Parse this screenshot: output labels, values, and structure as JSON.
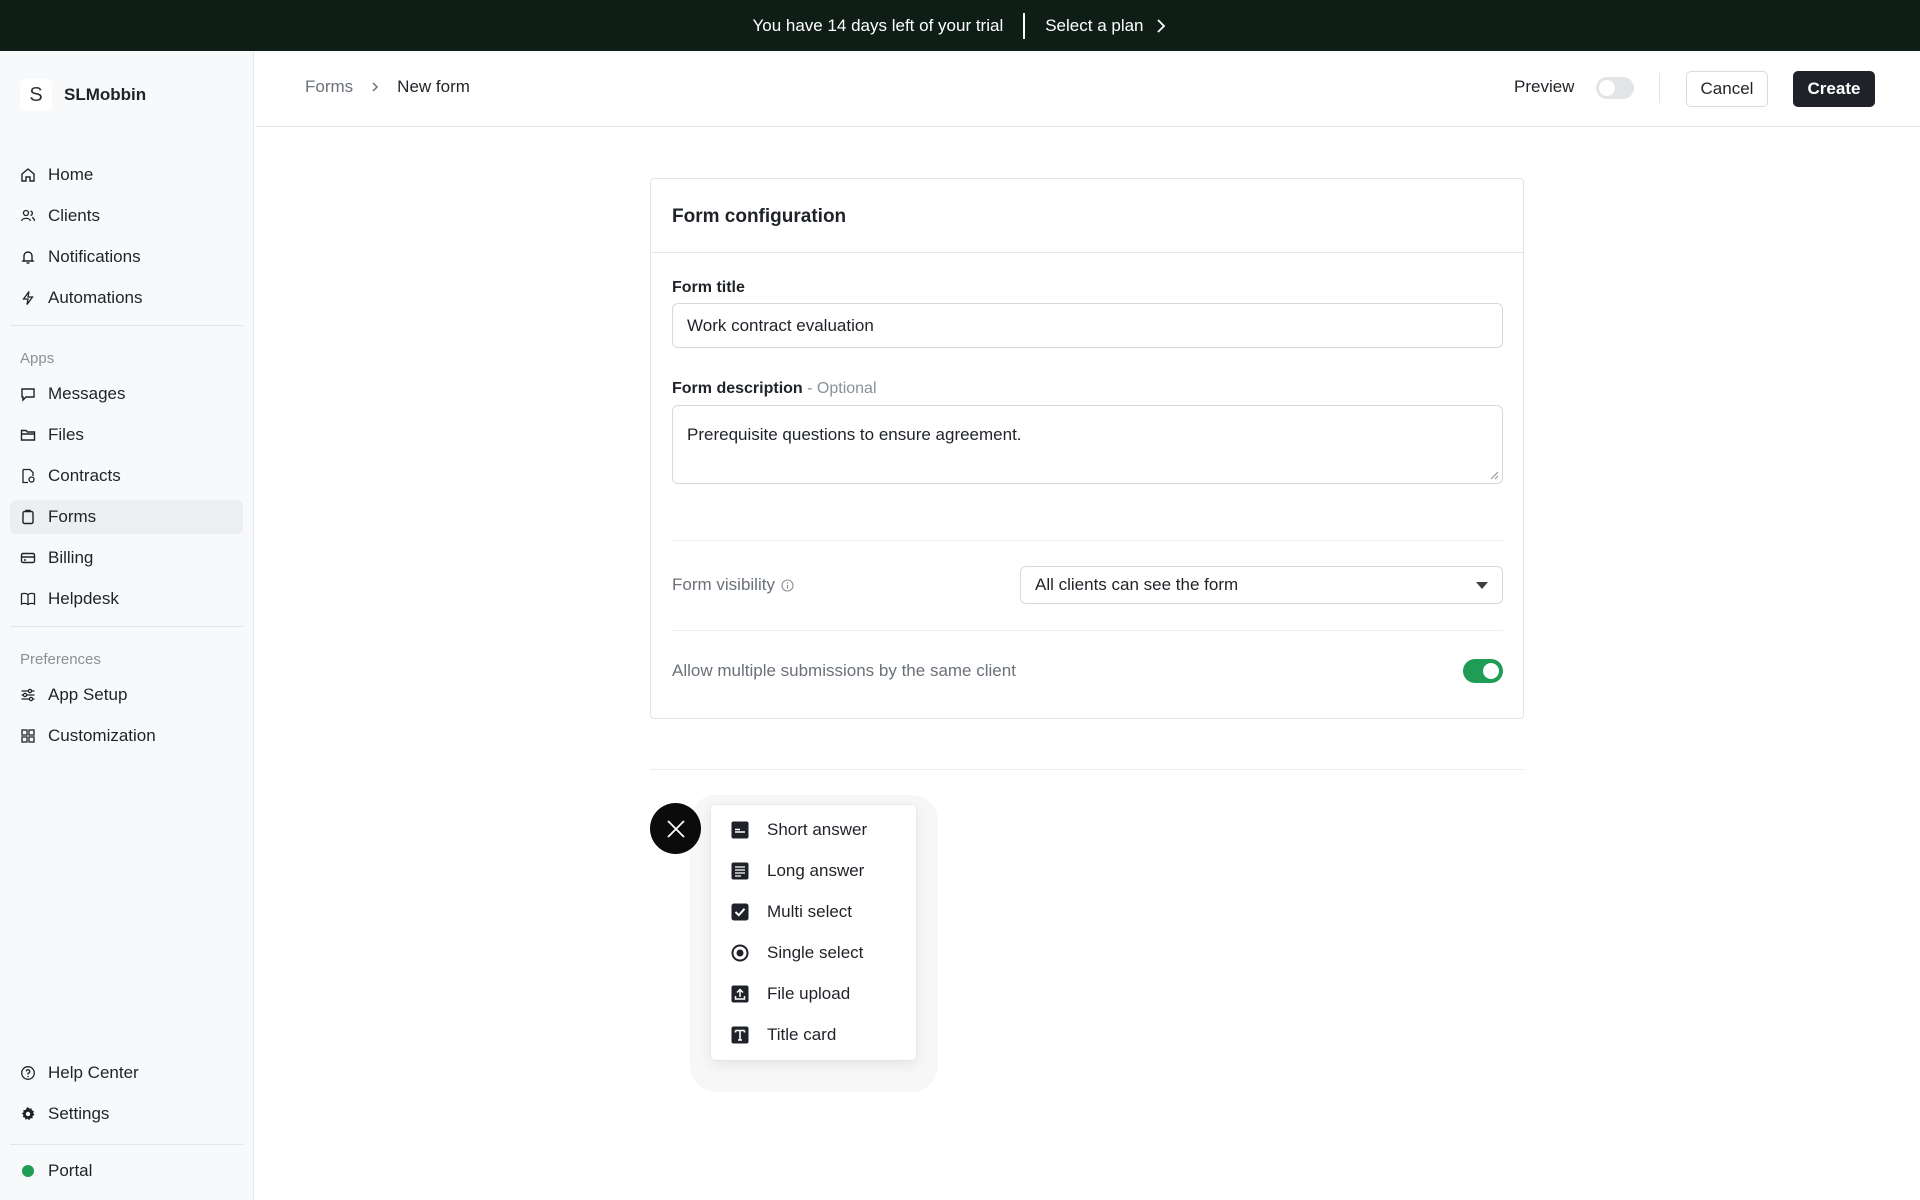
{
  "banner": {
    "trial_text": "You have 14 days left of your trial",
    "cta": "Select a plan"
  },
  "workspace": {
    "logo_letter": "S",
    "name": "SLMobbin"
  },
  "sidebar": {
    "main": [
      {
        "label": "Home",
        "icon": "home-icon"
      },
      {
        "label": "Clients",
        "icon": "users-icon"
      },
      {
        "label": "Notifications",
        "icon": "bell-icon"
      },
      {
        "label": "Automations",
        "icon": "bolt-icon"
      }
    ],
    "apps_label": "Apps",
    "apps": [
      {
        "label": "Messages",
        "icon": "message-icon"
      },
      {
        "label": "Files",
        "icon": "folder-icon"
      },
      {
        "label": "Contracts",
        "icon": "contract-icon"
      },
      {
        "label": "Forms",
        "icon": "clipboard-icon",
        "active": true
      },
      {
        "label": "Billing",
        "icon": "credit-card-icon"
      },
      {
        "label": "Helpdesk",
        "icon": "book-icon"
      }
    ],
    "prefs_label": "Preferences",
    "prefs": [
      {
        "label": "App Setup",
        "icon": "sliders-icon"
      },
      {
        "label": "Customization",
        "icon": "grid-icon"
      }
    ],
    "bottom": [
      {
        "label": "Help Center",
        "icon": "help-circle-icon"
      },
      {
        "label": "Settings",
        "icon": "gear-icon"
      }
    ],
    "portal": "Portal",
    "portal_status_color": "#1f9d55"
  },
  "header": {
    "breadcrumb": [
      "Forms",
      "New form"
    ],
    "preview_label": "Preview",
    "preview_enabled": false,
    "cancel_label": "Cancel",
    "create_label": "Create"
  },
  "form_config": {
    "title": "Form configuration",
    "form_title_label": "Form title",
    "form_title_value": "Work contract evaluation",
    "description_label": "Form description",
    "description_optional": " - Optional",
    "description_value": "Prerequisite questions to ensure agreement.",
    "visibility_label": "Form visibility",
    "visibility_value": "All clients can see the form",
    "multiple_label": "Allow multiple submissions by the same client",
    "multiple_enabled": true,
    "accent_color": "#1f9d55"
  },
  "add_menu": {
    "items": [
      {
        "label": "Short answer",
        "icon": "short-answer-icon"
      },
      {
        "label": "Long answer",
        "icon": "long-answer-icon"
      },
      {
        "label": "Multi select",
        "icon": "checkbox-icon"
      },
      {
        "label": "Single select",
        "icon": "radio-icon"
      },
      {
        "label": "File upload",
        "icon": "upload-icon"
      },
      {
        "label": "Title card",
        "icon": "title-card-icon"
      }
    ]
  }
}
